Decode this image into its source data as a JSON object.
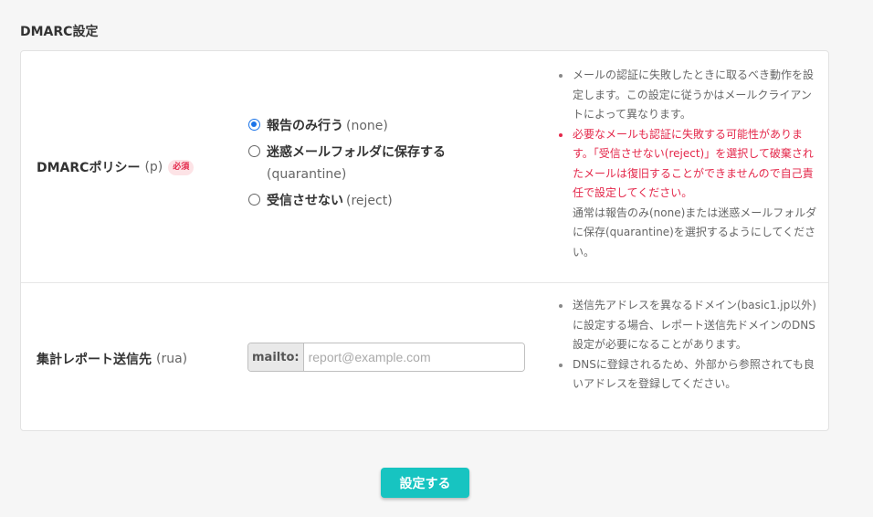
{
  "section": {
    "title": "DMARC設定"
  },
  "policy": {
    "label": "DMARCポリシー",
    "label_sub": "(p)",
    "required_badge": "必須",
    "options": [
      {
        "label": "報告のみ行う",
        "value_text": "(none)",
        "selected": true
      },
      {
        "label": "迷惑メールフォルダに保存する",
        "value_text": "(quarantine)",
        "selected": false
      },
      {
        "label": "受信させない",
        "value_text": "(reject)",
        "selected": false
      }
    ],
    "notes": {
      "note1": "メールの認証に失敗したときに取るべき動作を設定します。この設定に従うかはメールクライアントによって異なります。",
      "warning": "必要なメールも認証に失敗する可能性があります。「受信させない(reject)」を選択して破棄されたメールは復旧することができませんので自己責任で設定してください。",
      "note2": "通常は報告のみ(none)または迷惑メールフォルダに保存(quarantine)を選択するようにしてください。"
    }
  },
  "rua": {
    "label": "集計レポート送信先",
    "label_sub": "(rua)",
    "addon": "mailto:",
    "placeholder": "report@example.com",
    "value": "",
    "notes": {
      "note1": "送信先アドレスを異なるドメイン(basic1.jp以外)に設定する場合、レポート送信先ドメインのDNS設定が必要になることがあります。",
      "note2": "DNSに登録されるため、外部から参照されても良いアドレスを登録してください。"
    }
  },
  "actions": {
    "submit_label": "設定する"
  },
  "colors": {
    "accent": "#17c4c1",
    "warning": "#e4274a",
    "radio": "#1a73e8"
  }
}
